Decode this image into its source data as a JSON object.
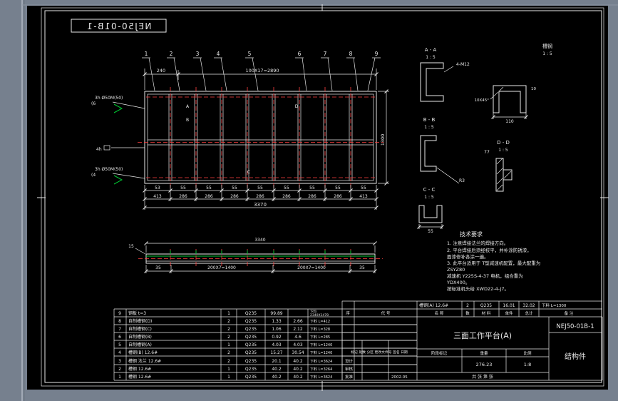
{
  "stamp": {
    "part_no": "NEJ50-01B-1"
  },
  "plan": {
    "balloons": [
      "1",
      "2",
      "3",
      "4",
      "5",
      "6",
      "7",
      "8",
      "9"
    ],
    "dim_240": "240",
    "dim_top": "100X17=2890",
    "dim_height": "1300",
    "dim_total": "3370",
    "row55": [
      "53",
      "55",
      "55",
      "55",
      "55",
      "55",
      "55",
      "55",
      "55"
    ],
    "row286": [
      "413",
      "286",
      "286",
      "286",
      "286",
      "286",
      "286",
      "286",
      "413"
    ],
    "weld_top": "3h Ø50M(50)",
    "weld_top_count": "(6",
    "weld_mid": "4h",
    "weld_bot": "3h Ø50M(50)",
    "weld_bot_count": "(4",
    "cut_a": "A",
    "cut_b": "B",
    "cut_c": "C",
    "cut_d": "D"
  },
  "side": {
    "dim_len": "3340",
    "dim_15": "15",
    "dim_left": "200X7=1400",
    "dim_right": "200X7=1400",
    "dim_35l": "35",
    "dim_35r": "35"
  },
  "sections": {
    "aa": {
      "title": "A - A",
      "scale": "1 : 5",
      "note": "4-M12"
    },
    "channel": {
      "title": "槽钢",
      "scale": "1 : 5",
      "chamfer": "10X45°",
      "dim110": "110",
      "dim10": "10"
    },
    "bb": {
      "title": "B - B",
      "scale": "1 : 5"
    },
    "dd": {
      "title": "D - D",
      "scale": "1 : 5",
      "dim77": "77"
    },
    "cc": {
      "title": "C - C",
      "scale": "1 : 5",
      "dim55": "55",
      "dimr3": "R3"
    }
  },
  "tech": {
    "title": "技术要求",
    "lines": [
      "1. 注意焊接法兰的焊接方向。",
      "2. 平台焊接后须经校平，并补涂防锈漆，",
      "    面漆修补各涂一遍。",
      "3. 此平台适用于 T型减速机配置，最大配重为",
      "    ZSYZ80",
      "    减速机 Y225S-4-37 电机，组合重为",
      "    YDX400。",
      "    按标准机头给 XWD22-4-J7。"
    ]
  },
  "bom": {
    "header": {
      "seq": "序",
      "code": "代  号",
      "name": "名  称",
      "qty": "数",
      "material": "材 料",
      "unit": "单件",
      "total": "总计",
      "remark": "备  注"
    },
    "top_row": {
      "name": "槽钢(A) 12.6#",
      "qty": "2",
      "material": "Q235",
      "unit": "16.01",
      "total": "32.02",
      "remark": "下料 L=1300"
    },
    "rows": [
      {
        "seq": "9",
        "name": "钢板 t=3",
        "qty": "1",
        "material": "Q235",
        "unit": "99.89",
        "total": "",
        "remark": "下料",
        "remark2": "2340X1478"
      },
      {
        "seq": "8",
        "name": "自制槽钢(D)",
        "qty": "2",
        "material": "Q235",
        "unit": "1.33",
        "total": "2.66",
        "remark": "下料 L=412",
        "remark2": ""
      },
      {
        "seq": "7",
        "name": "自制槽钢(C)",
        "qty": "2",
        "material": "Q235",
        "unit": "1.06",
        "total": "2.12",
        "remark": "下料 L=328",
        "remark2": ""
      },
      {
        "seq": "6",
        "name": "自制槽钢(B)",
        "qty": "2",
        "material": "Q235",
        "unit": "0.92",
        "total": "4.6",
        "remark": "下料 L=285",
        "remark2": ""
      },
      {
        "seq": "5",
        "name": "自制槽钢(A)",
        "qty": "1",
        "material": "Q235",
        "unit": "4.03",
        "total": "4.03",
        "remark": "下料 L=1240",
        "remark2": ""
      },
      {
        "seq": "4",
        "name": "槽钢(B) 12.6#",
        "qty": "2",
        "material": "Q235",
        "unit": "15.27",
        "total": "30.54",
        "remark": "下料 L=1240",
        "remark2": ""
      },
      {
        "seq": "3",
        "name": "槽钢 法兰 12.6#",
        "qty": "2",
        "material": "Q235",
        "unit": "20.1",
        "total": "40.2",
        "remark": "下料 L=3624",
        "remark2": ""
      },
      {
        "seq": "2",
        "name": "槽钢 12.6#",
        "qty": "1",
        "material": "Q235",
        "unit": "40.2",
        "total": "40.2",
        "remark": "下料 L=3264",
        "remark2": ""
      },
      {
        "seq": "1",
        "name": "槽钢 12.6#",
        "qty": "1",
        "material": "Q235",
        "unit": "40.2",
        "total": "40.2",
        "remark": "下料 L=3624",
        "remark2": ""
      }
    ]
  },
  "titleblock": {
    "part_no": "NEJ50-01B-1",
    "title": "三面工作平台(A)",
    "subtitle": "结构件",
    "stage_label": "阶段标记",
    "weight_label": "重量",
    "scale_label": "比例",
    "weight": "276.23",
    "scale": "1:8",
    "sheet": "共  张  第  张",
    "rev_header": "标记 处数 分区 更改文件号 签名 日期",
    "design": "设计",
    "check": "审核",
    "approve": "批准",
    "date": "2002.05"
  }
}
